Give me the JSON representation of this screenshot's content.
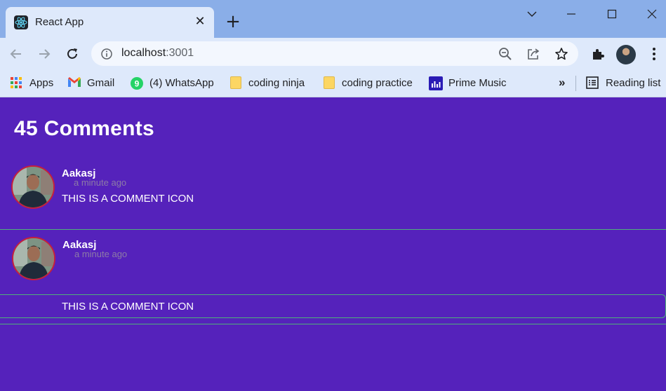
{
  "browser": {
    "tab": {
      "title": "React App",
      "close_glyph": "✕"
    },
    "new_tab_glyph": "+",
    "omnibox": {
      "host": "localhost",
      "port": ":3001"
    },
    "bookmarks": [
      {
        "label": "Apps",
        "icon": "apps-grid-icon"
      },
      {
        "label": "Gmail",
        "icon": "gmail-icon"
      },
      {
        "label": "(4) WhatsApp",
        "icon": "whatsapp-icon",
        "badge": "9"
      },
      {
        "label": "coding ninja",
        "icon": "folder-icon"
      },
      {
        "label": "coding practice",
        "icon": "folder-icon"
      },
      {
        "label": "Prime Music",
        "icon": "prime-music-icon"
      }
    ],
    "more_bookmarks_glyph": "»",
    "reading_list": "Reading list"
  },
  "page": {
    "heading": "45 Comments",
    "comments": [
      {
        "author": "Aakasj",
        "time": "a minute ago",
        "text": "THIS IS A COMMENT ICON"
      },
      {
        "author": "Aakasj",
        "time": "a minute ago",
        "text": "THIS IS A COMMENT ICON"
      }
    ]
  },
  "colors": {
    "page_bg": "#5522bb",
    "divider": "#4fb07a",
    "avatar_ring": "#c81e3c",
    "time_text": "#8d7ba7",
    "titlebar": "#8aaee8",
    "toolbar": "#dee9fb"
  }
}
